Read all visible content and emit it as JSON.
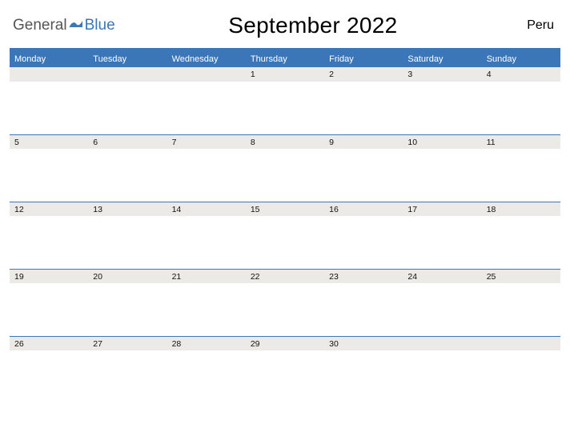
{
  "logo": {
    "text1": "General",
    "text2": "Blue"
  },
  "title": "September 2022",
  "region": "Peru",
  "day_headers": [
    "Monday",
    "Tuesday",
    "Wednesday",
    "Thursday",
    "Friday",
    "Saturday",
    "Sunday"
  ],
  "weeks": [
    [
      "",
      "",
      "",
      "1",
      "2",
      "3",
      "4"
    ],
    [
      "5",
      "6",
      "7",
      "8",
      "9",
      "10",
      "11"
    ],
    [
      "12",
      "13",
      "14",
      "15",
      "16",
      "17",
      "18"
    ],
    [
      "19",
      "20",
      "21",
      "22",
      "23",
      "24",
      "25"
    ],
    [
      "26",
      "27",
      "28",
      "29",
      "30",
      "",
      ""
    ]
  ],
  "colors": {
    "accent": "#3a76b8",
    "strip": "#eceae6"
  }
}
